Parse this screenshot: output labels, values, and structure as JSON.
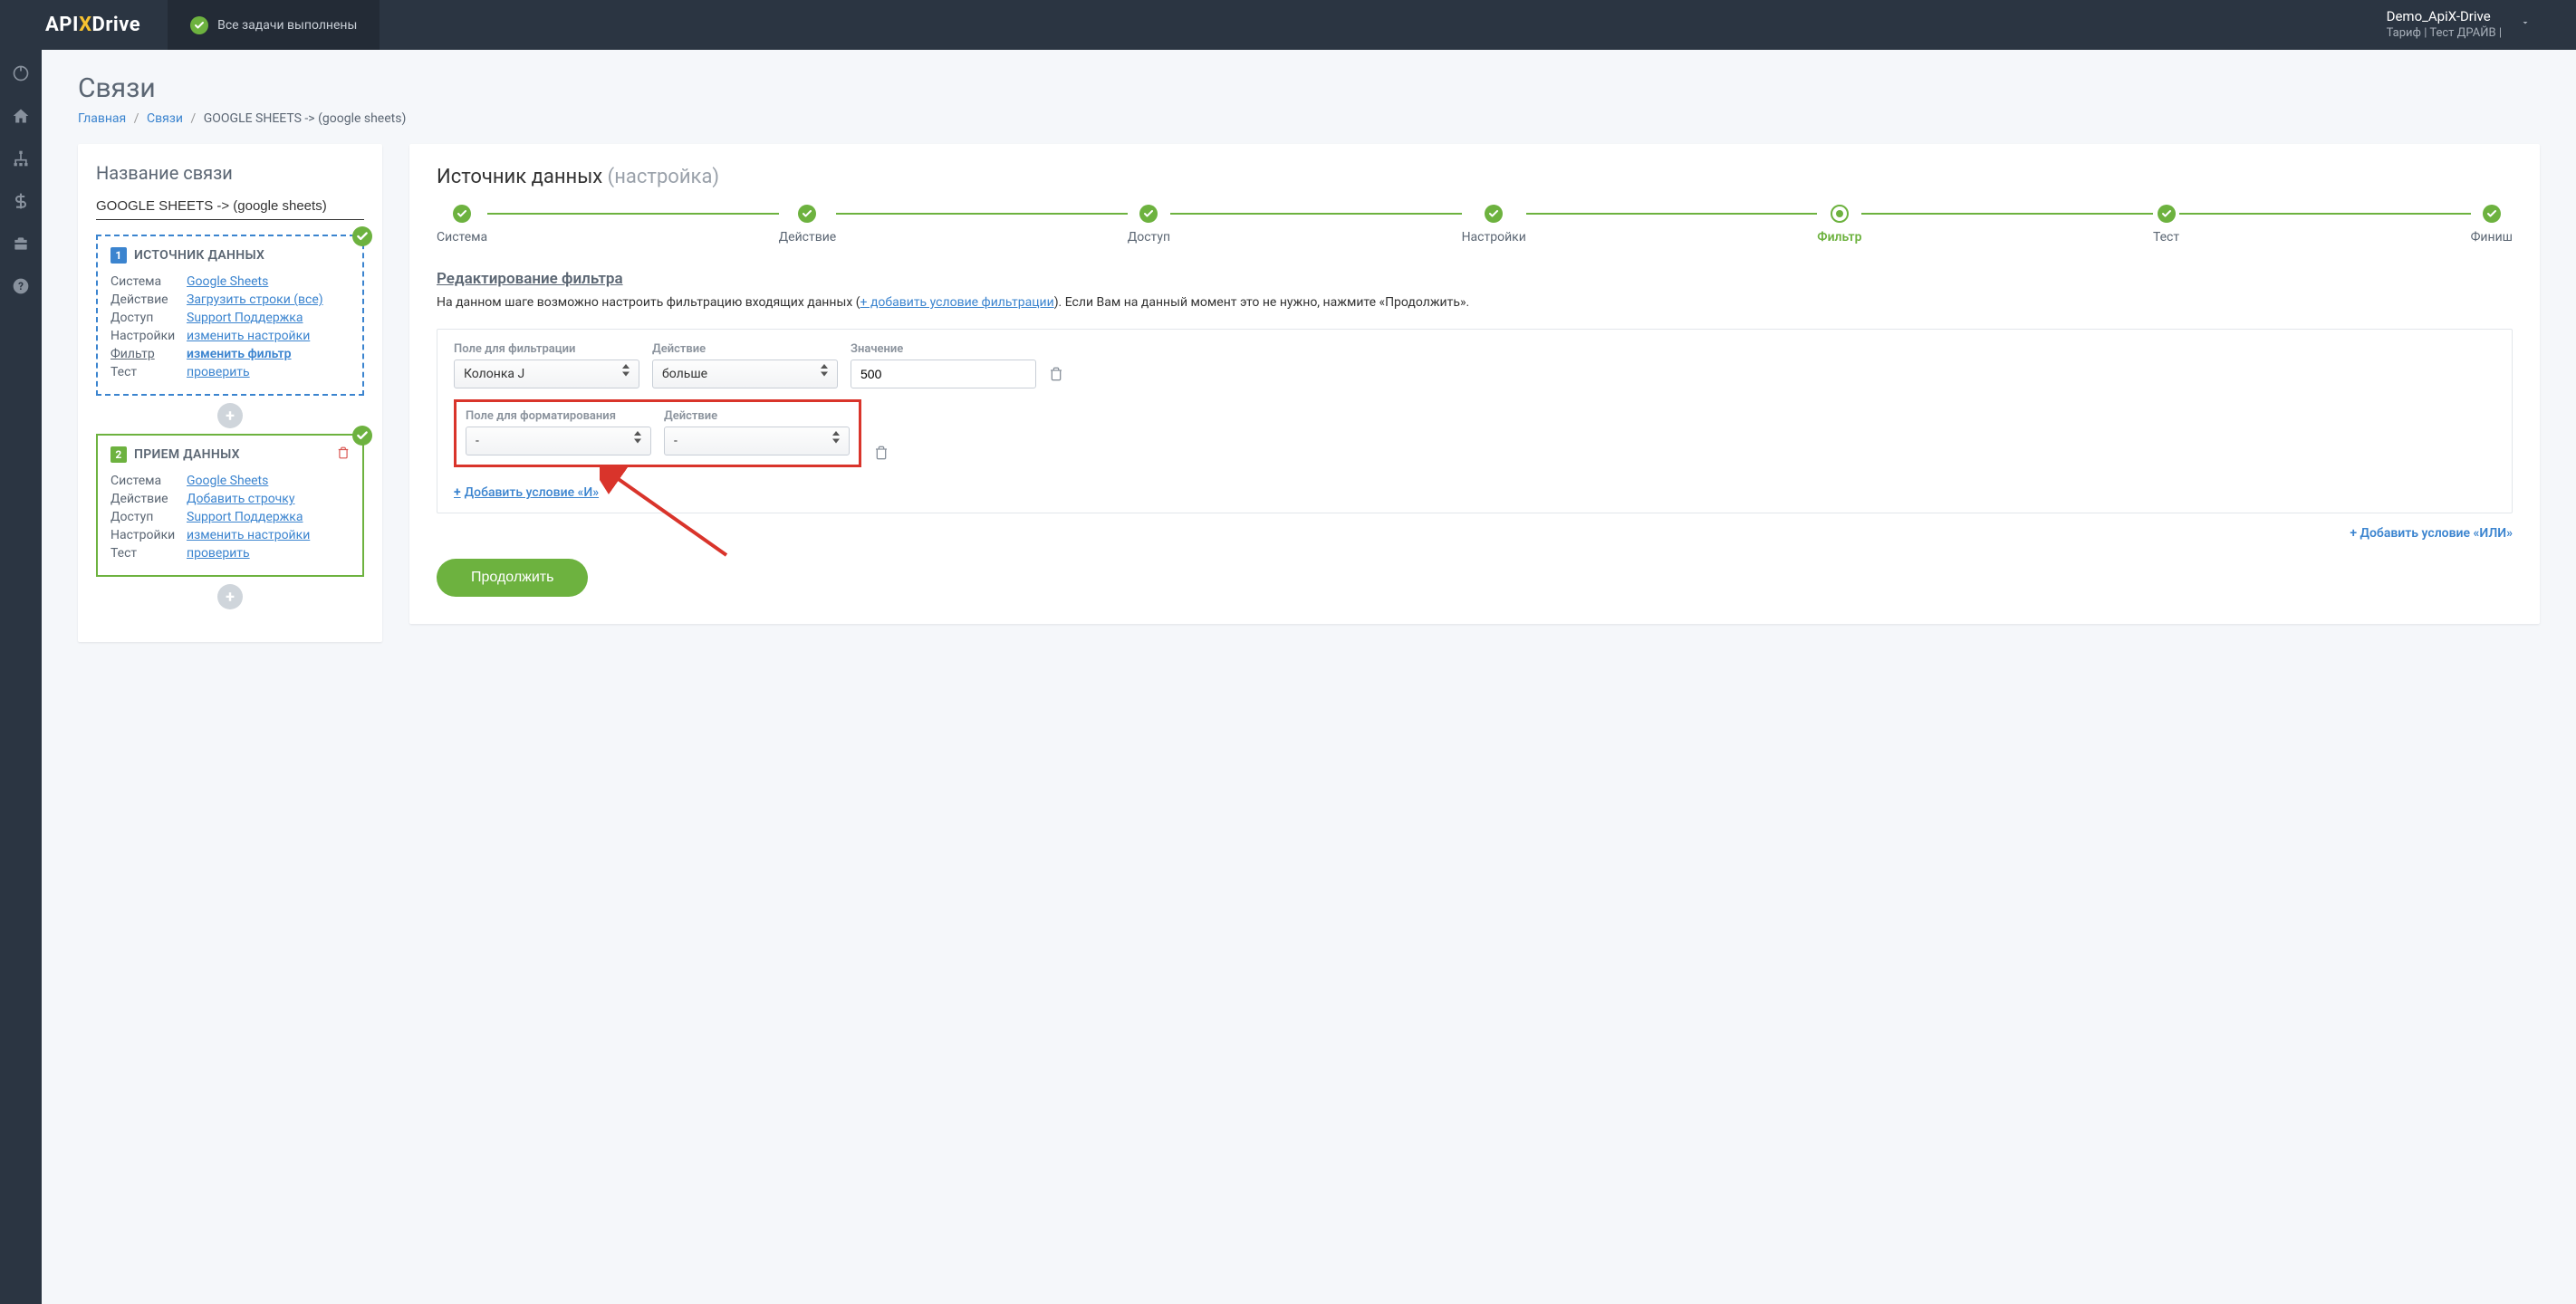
{
  "header": {
    "logo_api": "API",
    "logo_x": "X",
    "logo_drive": "Drive",
    "status_text": "Все задачи выполнены",
    "user_name": "Demo_ApiX-Drive",
    "tariff_line": "Тариф | Тест ДРАЙВ |"
  },
  "page": {
    "title": "Связи"
  },
  "breadcrumbs": {
    "home": "Главная",
    "links": "Связи",
    "current": "GOOGLE SHEETS -> (google sheets)"
  },
  "left_panel": {
    "heading": "Название связи",
    "conn_name": "GOOGLE SHEETS -> (google sheets)",
    "source": {
      "num": "1",
      "title": "ИСТОЧНИК ДАННЫХ",
      "rows": [
        {
          "label": "Система",
          "value": "Google Sheets"
        },
        {
          "label": "Действие",
          "value": "Загрузить строки (все)"
        },
        {
          "label": "Доступ",
          "value": "Support Поддержка"
        },
        {
          "label": "Настройки",
          "value": "изменить настройки"
        },
        {
          "label": "Фильтр",
          "value": "изменить фильтр",
          "current": true
        },
        {
          "label": "Тест",
          "value": "проверить"
        }
      ]
    },
    "dest": {
      "num": "2",
      "title": "ПРИЕМ ДАННЫХ",
      "rows": [
        {
          "label": "Система",
          "value": "Google Sheets"
        },
        {
          "label": "Действие",
          "value": "Добавить строчку"
        },
        {
          "label": "Доступ",
          "value": "Support Поддержка"
        },
        {
          "label": "Настройки",
          "value": "изменить настройки"
        },
        {
          "label": "Тест",
          "value": "проверить"
        }
      ]
    }
  },
  "right_panel": {
    "heading_main": "Источник данных",
    "heading_muted": "(настройка)",
    "steps": [
      {
        "label": "Система",
        "state": "done"
      },
      {
        "label": "Действие",
        "state": "done"
      },
      {
        "label": "Доступ",
        "state": "done"
      },
      {
        "label": "Настройки",
        "state": "done"
      },
      {
        "label": "Фильтр",
        "state": "current"
      },
      {
        "label": "Тест",
        "state": "done"
      },
      {
        "label": "Финиш",
        "state": "done"
      }
    ],
    "section_title": "Редактирование фильтра",
    "section_desc_before": "На данном шаге возможно настроить фильтрацию входящих данных (",
    "section_desc_link": "+ добавить условие фильтрации",
    "section_desc_after": "). Если Вам на данный момент это не нужно, нажмите «Продолжить».",
    "filter": {
      "col_field": "Поле для фильтрации",
      "col_action": "Действие",
      "col_value": "Значение",
      "row1_field": "Колонка J",
      "row1_action": "больше",
      "row1_value": "500",
      "col_format": "Поле для форматирования",
      "col_format_action": "Действие",
      "row2_field": "-",
      "row2_action": "-",
      "add_and": "Добавить условие «И»",
      "add_or": "+  Добавить условие «ИЛИ»"
    },
    "continue": "Продолжить"
  }
}
